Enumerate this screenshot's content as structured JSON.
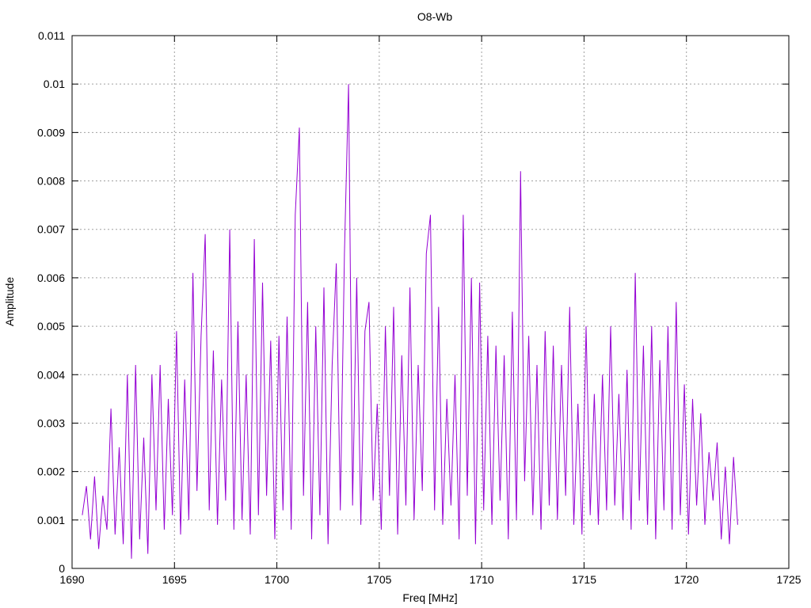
{
  "chart_data": {
    "type": "line",
    "title": "O8-Wb",
    "xlabel": "Freq [MHz]",
    "ylabel": "Amplitude",
    "xlim": [
      1690,
      1725
    ],
    "ylim": [
      0,
      0.011
    ],
    "xticks": [
      1690,
      1695,
      1700,
      1705,
      1710,
      1715,
      1720,
      1725
    ],
    "xtick_labels": [
      "1690",
      "1695",
      "1700",
      "1705",
      "1710",
      "1715",
      "1720",
      "1725"
    ],
    "yticks": [
      0,
      0.001,
      0.002,
      0.003,
      0.004,
      0.005,
      0.006,
      0.007,
      0.008,
      0.009,
      0.01,
      0.011
    ],
    "ytick_labels": [
      "0",
      "0.001",
      "0.002",
      "0.003",
      "0.004",
      "0.005",
      "0.006",
      "0.007",
      "0.008",
      "0.009",
      "0.01",
      "0.011"
    ],
    "grid": true,
    "series_color": "#9400D3",
    "x_start": 1690.5,
    "x_step": 0.2,
    "values": [
      0.0011,
      0.0017,
      0.0006,
      0.0019,
      0.0004,
      0.0015,
      0.0008,
      0.0033,
      0.0007,
      0.0025,
      0.0005,
      0.004,
      0.0002,
      0.0042,
      0.0006,
      0.0027,
      0.0003,
      0.004,
      0.0012,
      0.0042,
      0.0008,
      0.0035,
      0.0011,
      0.0049,
      0.0007,
      0.0039,
      0.001,
      0.0061,
      0.0016,
      0.0048,
      0.0069,
      0.0012,
      0.0045,
      0.0009,
      0.0039,
      0.0014,
      0.007,
      0.0008,
      0.0051,
      0.001,
      0.004,
      0.0007,
      0.0068,
      0.0011,
      0.0059,
      0.0015,
      0.0047,
      0.0006,
      0.0048,
      0.0012,
      0.0052,
      0.0008,
      0.0073,
      0.0091,
      0.0015,
      0.0055,
      0.0006,
      0.005,
      0.0011,
      0.0058,
      0.0005,
      0.0042,
      0.0063,
      0.0012,
      0.0065,
      0.01,
      0.0013,
      0.006,
      0.0009,
      0.0049,
      0.0055,
      0.0014,
      0.0034,
      0.0008,
      0.005,
      0.0015,
      0.0054,
      0.0007,
      0.0044,
      0.0013,
      0.0058,
      0.001,
      0.0042,
      0.0016,
      0.0065,
      0.0073,
      0.0012,
      0.0054,
      0.0009,
      0.0035,
      0.0013,
      0.004,
      0.0006,
      0.0073,
      0.0015,
      0.006,
      0.0005,
      0.0059,
      0.0012,
      0.0048,
      0.0009,
      0.0046,
      0.0014,
      0.0044,
      0.0006,
      0.0053,
      0.001,
      0.0082,
      0.0018,
      0.0048,
      0.0011,
      0.0042,
      0.0008,
      0.0049,
      0.0013,
      0.0046,
      0.001,
      0.0042,
      0.0015,
      0.0054,
      0.0009,
      0.0034,
      0.0007,
      0.005,
      0.0011,
      0.0036,
      0.0009,
      0.004,
      0.0012,
      0.005,
      0.0013,
      0.0036,
      0.001,
      0.0041,
      0.0008,
      0.0061,
      0.0014,
      0.0046,
      0.0009,
      0.005,
      0.0006,
      0.0043,
      0.0012,
      0.005,
      0.0008,
      0.0055,
      0.0011,
      0.0038,
      0.0007,
      0.0035,
      0.0013,
      0.0032,
      0.0009,
      0.0024,
      0.0014,
      0.0026,
      0.0006,
      0.0021,
      0.0005,
      0.0023,
      0.0009
    ]
  }
}
